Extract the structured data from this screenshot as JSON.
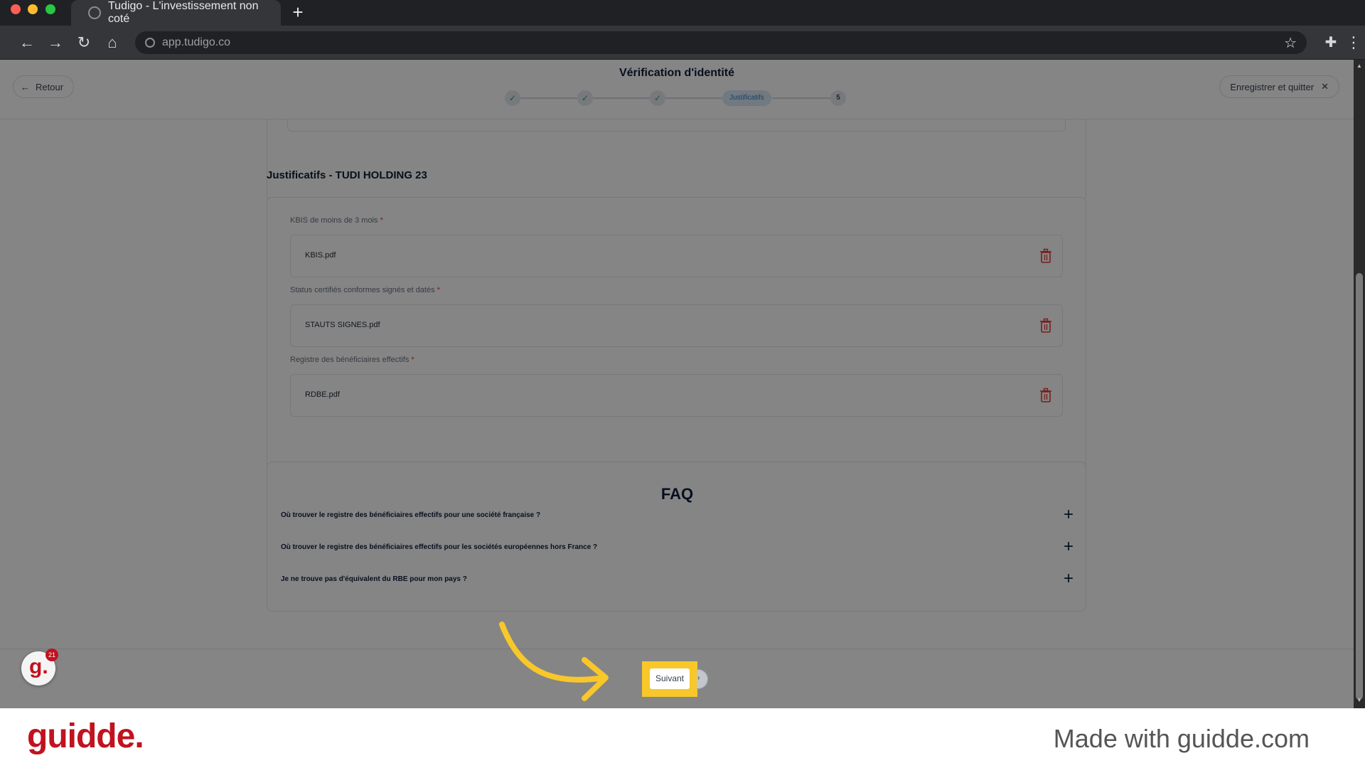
{
  "browser": {
    "tab_title": "Tudigo - L'investissement non coté",
    "new_tab": "+",
    "url": "app.tudigo.co"
  },
  "header": {
    "back_label": "Retour",
    "title": "Vérification d'identité",
    "steps": [
      {
        "state": "done",
        "glyph": "✓"
      },
      {
        "state": "done",
        "glyph": "✓"
      },
      {
        "state": "done",
        "glyph": "✓"
      },
      {
        "state": "current",
        "label": "Justificatifs"
      },
      {
        "state": "upcoming",
        "label": "5"
      }
    ],
    "save_quit_label": "Enregistrer et quitter",
    "close_glyph": "✕"
  },
  "section": {
    "title": "Justificatifs - TUDI HOLDING 23"
  },
  "documents": [
    {
      "label": "KBIS de moins de 3 mois",
      "required_mark": "*",
      "file": "KBIS.pdf"
    },
    {
      "label": "Status certifiés conformes signés et datés",
      "required_mark": "*",
      "file": "STAUTS SIGNES.pdf"
    },
    {
      "label": "Registre des bénéficiaires effectifs",
      "required_mark": "*",
      "file": "RDBE.pdf"
    }
  ],
  "faq": {
    "title": "FAQ",
    "items": [
      {
        "question": "Où trouver le registre des bénéficiaires effectifs pour une société française ?",
        "toggle": "+"
      },
      {
        "question": "Où trouver le registre des bénéficiaires effectifs pour les sociétés européennes hors France ?",
        "toggle": "+"
      },
      {
        "question": "Je ne trouve pas d'équivalent du RBE pour mon pays ?",
        "toggle": "+"
      }
    ]
  },
  "footer": {
    "next_label": "Suivant",
    "next_glyph": "›"
  },
  "guidde_badge": {
    "letter": "g.",
    "count": "21"
  },
  "brand": {
    "logo_text": "guidde.",
    "made_with": "Made with guidde.com"
  },
  "colors": {
    "highlight": "#f8c72a",
    "arrow": "#f8c72a",
    "brand_red": "#c1121f",
    "trash": "#e53935",
    "step_check": "#27a27b"
  }
}
